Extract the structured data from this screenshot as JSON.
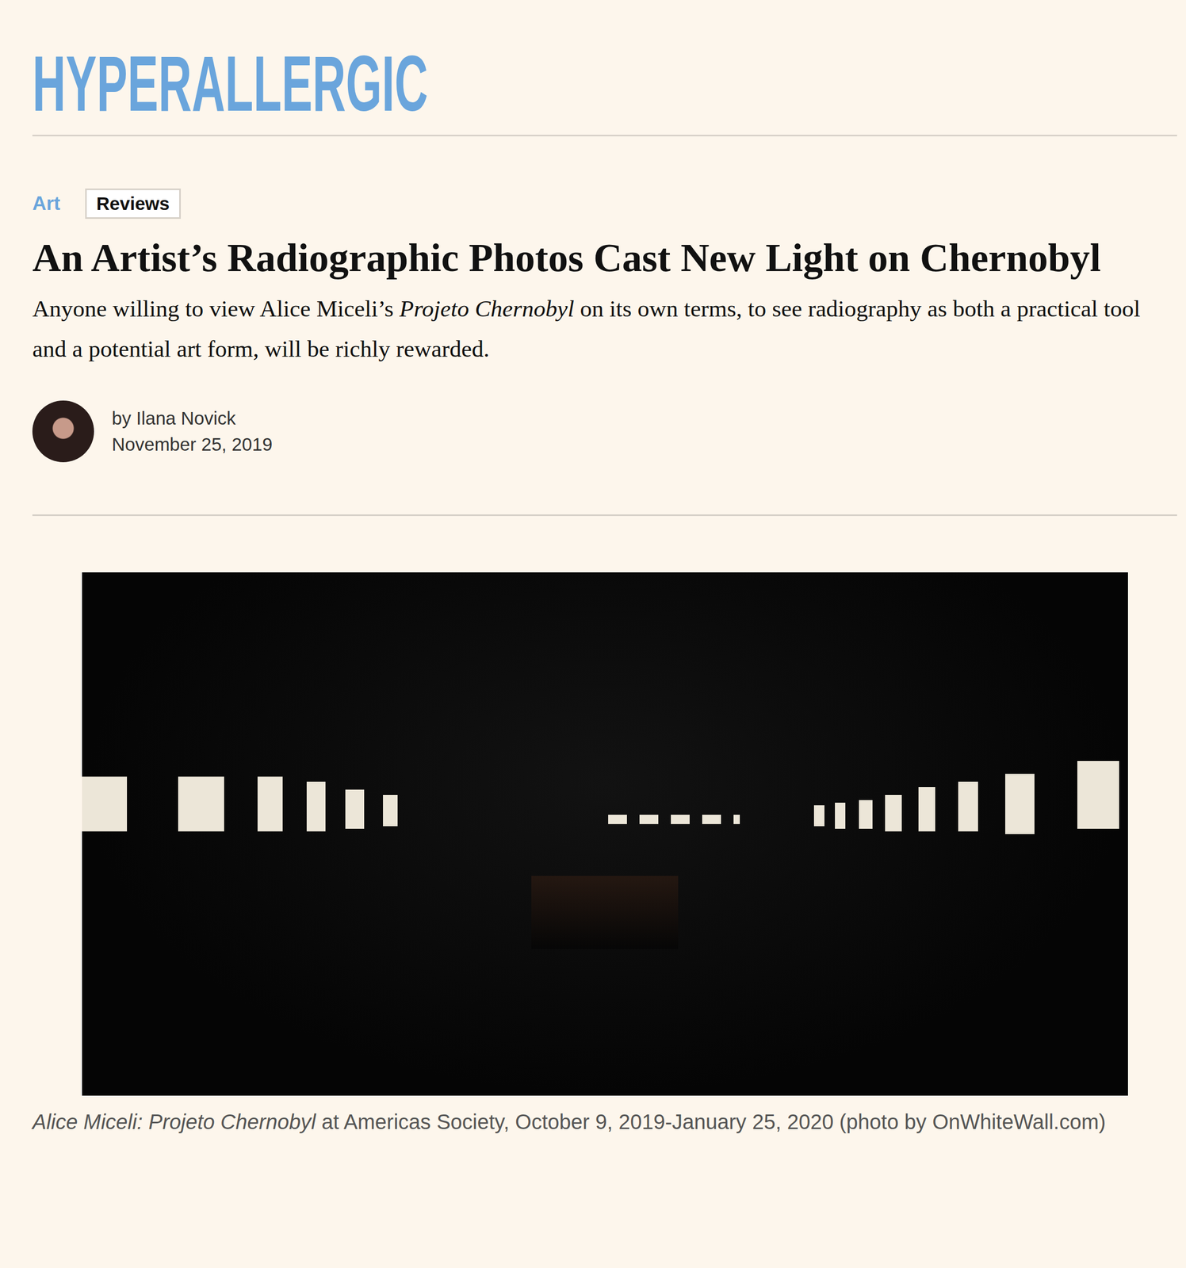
{
  "site": {
    "logo": "HYPERALLERGIC"
  },
  "article": {
    "category": "Art",
    "tag": "Reviews",
    "title": "An Artist’s Radiographic Photos Cast New Light on Chernobyl",
    "subtitle": [
      {
        "text": "Anyone willing to view Alice Miceli’s ",
        "italic": false
      },
      {
        "text": "Projeto Chernobyl",
        "italic": true
      },
      {
        "text": " on its own terms, to see radiography as both a practical tool and a potential art form, will be richly rewarded.",
        "italic": false
      }
    ],
    "byline": "by Ilana Novick",
    "date": "November 25, 2019"
  },
  "image": {
    "caption": [
      {
        "text": "Alice Miceli: Projeto Chernobyl",
        "italic": true
      },
      {
        "text": " at Americas Society, October 9, 2019-January 25, 2020 (photo by OnWhiteWall.com)",
        "italic": false
      }
    ]
  }
}
